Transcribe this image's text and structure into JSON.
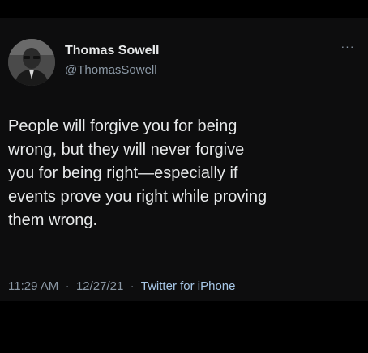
{
  "tweet": {
    "author": {
      "name": "Thomas Sowell",
      "handle": "@ThomasSowell"
    },
    "more_icon": "more-options-icon",
    "more_glyph": "···",
    "text_lines": [
      "People will forgive you for being",
      "wrong, but they will never forgive",
      "you for being right—especially if",
      "events prove you right while proving",
      "them wrong."
    ],
    "meta": {
      "time": "11:29 AM",
      "separator": "·",
      "date": "12/27/21",
      "source": "Twitter for iPhone"
    },
    "colors": {
      "background": "#0d0d0e",
      "text": "#e7e9ea",
      "secondary": "#8b98a5"
    }
  }
}
